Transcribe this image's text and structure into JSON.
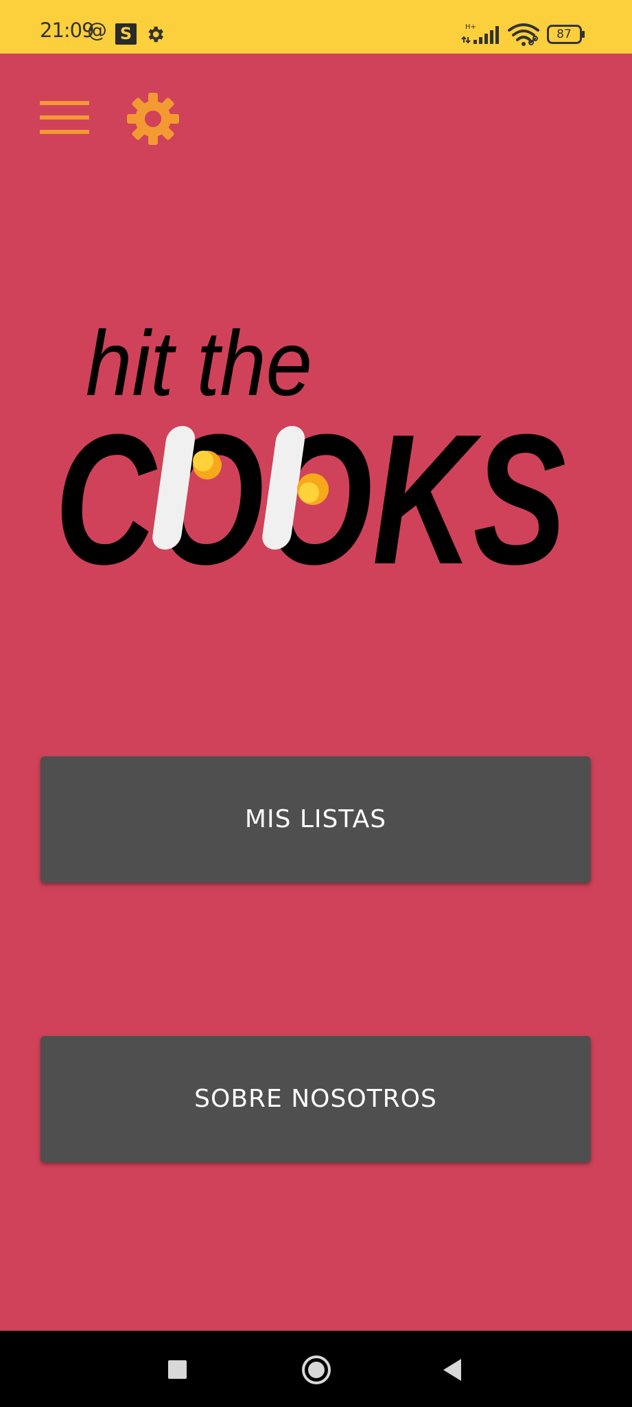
{
  "status_bar": {
    "time": "21:09",
    "at_symbol": "@",
    "s_app_badge": "S",
    "network_type": "H+",
    "battery_level": "87",
    "icons": [
      "settings-gear-icon",
      "signal-strength-icon",
      "wifi-icon",
      "battery-icon"
    ]
  },
  "app_bar": {
    "icons": [
      "hamburger-menu-icon",
      "settings-gear-icon"
    ]
  },
  "logo": {
    "line1": "hit the",
    "line2": "COOKS"
  },
  "buttons": {
    "lists_label": "MIS LISTAS",
    "about_label": "SOBRE NOSOTROS"
  },
  "nav_bar": {
    "icons": [
      "recents-square-icon",
      "home-circle-icon",
      "back-triangle-icon"
    ]
  },
  "colors": {
    "background": "#cf4259",
    "status_bar": "#fccf3d",
    "accent_icons": "#f39a32",
    "button_bg": "#4f4f4f",
    "button_text": "#ffffff",
    "nav_bar": "#000000"
  }
}
